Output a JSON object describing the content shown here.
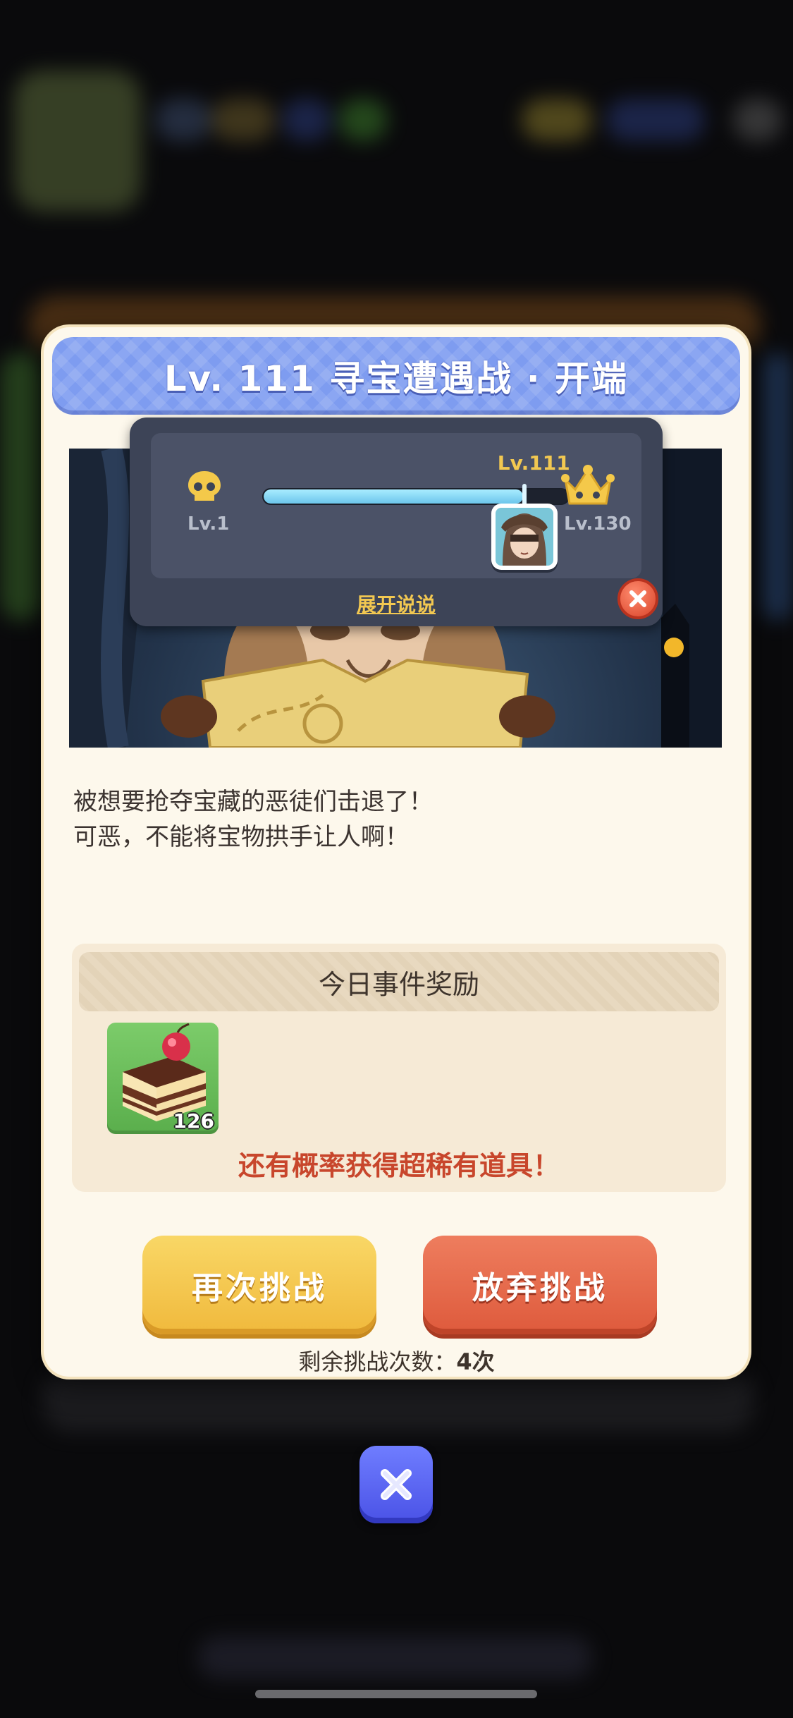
{
  "dialog": {
    "title": "Lv. 111 寻宝遭遇战 · 开端",
    "progress": {
      "min_label": "Lv.1",
      "max_label": "Lv.130",
      "current_label": "Lv.111",
      "current_level": 111,
      "max_level": 130,
      "expand_label": "展开说说",
      "icons": {
        "start": "skull-icon",
        "end": "crown-icon",
        "close": "close-icon"
      }
    },
    "description": {
      "line1": "被想要抢夺宝藏的恶徒们击退了！",
      "line2": "可恶，不能将宝物拱手让人啊！"
    },
    "reward": {
      "header": "今日事件奖励",
      "item": {
        "icon": "cake-icon",
        "count": "126"
      },
      "note": "还有概率获得超稀有道具！"
    },
    "buttons": {
      "retry_label": "再次挑战",
      "abandon_label": "放弃挑战"
    },
    "remaining": {
      "label": "剩余挑战次数：",
      "value": "4次"
    }
  },
  "close_button_icon": "close-icon",
  "colors": {
    "title_bar": "#7e9cf0",
    "retry_button": "#f3c24a",
    "abandon_button": "#e2603f",
    "rare_note": "#c8462c",
    "progress_fill": "#7fd4f2",
    "close_button": "#5a62f0"
  }
}
